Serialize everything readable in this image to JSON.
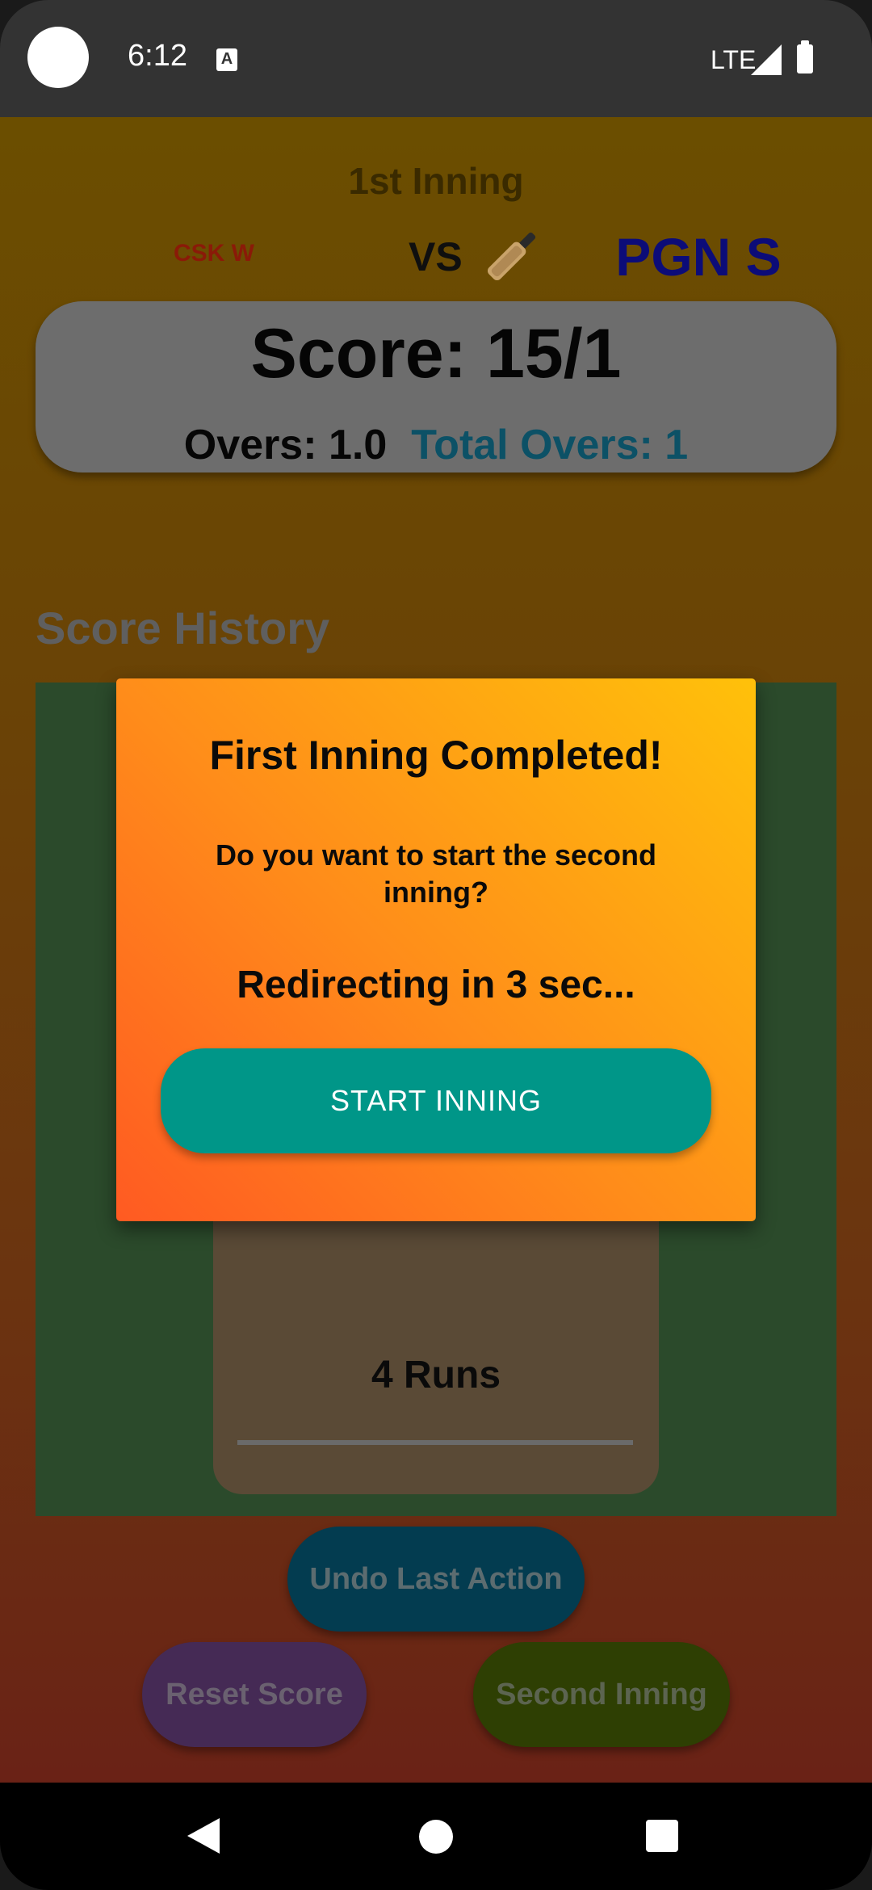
{
  "status_bar": {
    "time": "6:12",
    "network": "LTE"
  },
  "match": {
    "inning_title": "1st Inning",
    "team_a": "CSK W",
    "vs_label": "VS",
    "team_b": "PGN S"
  },
  "score_card": {
    "score": "Score: 15/1",
    "overs": "Overs: 1.0",
    "total_overs": "Total Overs: 1"
  },
  "history": {
    "title": "Score History",
    "entries": [
      "4 Runs"
    ]
  },
  "actions": {
    "undo_label": "Undo Last Action",
    "reset_label": "Reset Score",
    "second_inning_label": "Second Inning"
  },
  "dialog": {
    "title": "First Inning Completed!",
    "message": "Do you want to start the second inning?",
    "countdown": "Redirecting in 3 sec...",
    "start_label": "START INNING"
  },
  "colors": {
    "team_a": "#8a1a08",
    "team_b": "#0c0c78",
    "start_button": "#009688",
    "total_overs": "#0c5166"
  },
  "icons": {
    "bat": "cricket-bat-icon"
  }
}
